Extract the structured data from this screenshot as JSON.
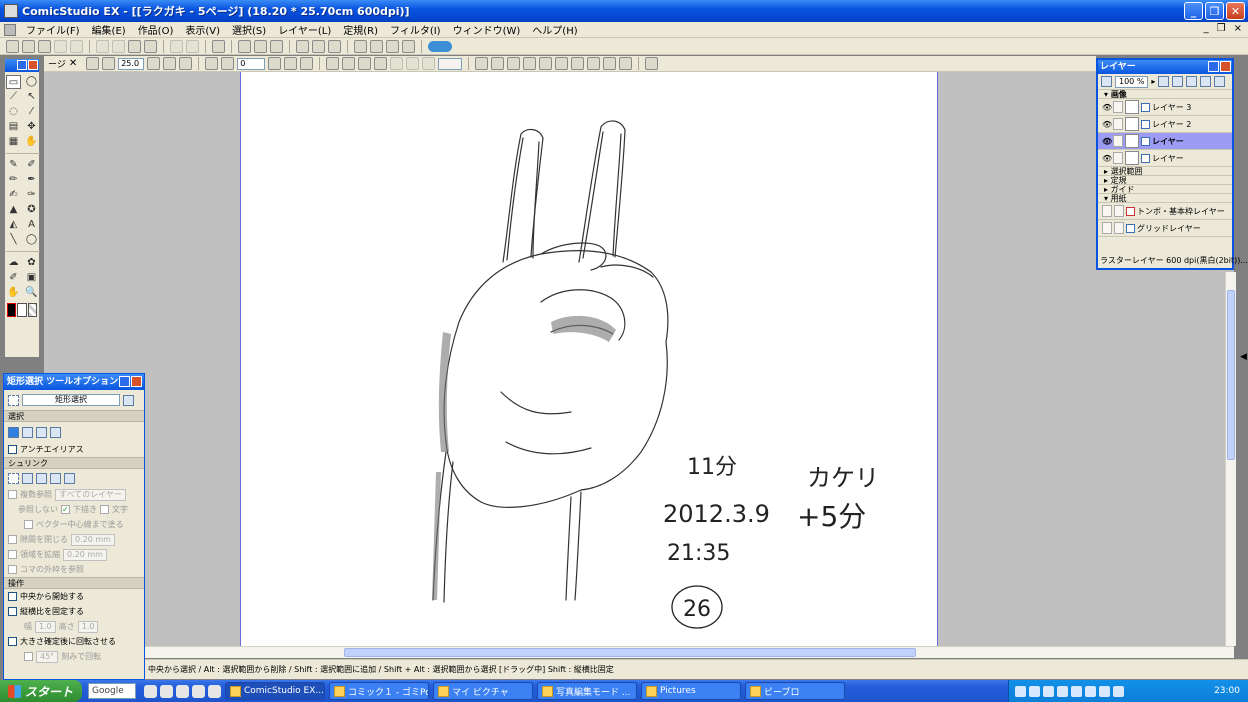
{
  "window": {
    "title": "ComicStudio EX - [[ラクガキ - 5ページ] (18.20 * 25.70cm 600dpi)]",
    "min_label": "_",
    "max_label": "❐",
    "close_label": "✕"
  },
  "menu": {
    "items": [
      "ファイル(F)",
      "編集(E)",
      "作品(O)",
      "表示(V)",
      "選択(S)",
      "レイヤー(L)",
      "定規(R)",
      "フィルタ(I)",
      "ウィンドウ(W)",
      "ヘルプ(H)"
    ],
    "mdi_min": "_",
    "mdi_restore": "❐",
    "mdi_close": "×"
  },
  "toolbar2": {
    "tab_label": "ージ",
    "tab_close": "✕",
    "zoom_value": "25.0",
    "rotate_value": "0"
  },
  "tool_palette": {
    "tools": [
      "▭",
      "◯",
      "⟋",
      "↖",
      "◌",
      "⁄",
      "▤",
      "✥",
      "▦",
      "✋",
      "✎",
      "✐",
      "✏",
      "✒",
      "✍",
      "✑",
      "▲",
      "✪",
      "◭",
      "A",
      "╲",
      "◯",
      "☁",
      "✿",
      "✐",
      "▣",
      "✋",
      "🔍"
    ],
    "colors": {
      "main": "#000000",
      "sub": "#ffffff",
      "transparent": "#d0d0d0"
    }
  },
  "tool_options": {
    "title": "矩形選択 ツールオプション",
    "tool_name": "矩形選択",
    "sections": {
      "selection": "選択",
      "sampling": "シュリンク",
      "operation": "操作"
    },
    "antialias": "アンチエイリアス",
    "multi_ref": "複数参照",
    "multi_ref_value": "すべてのレイヤー",
    "no_ref": "参照しない",
    "lower": "下描き",
    "text": "文字",
    "vector_center": "ベクター中心線まで塗る",
    "close_gap": "隙間を閉じる",
    "close_gap_value": "0.20 mm",
    "expand": "領域を拡縮",
    "expand_value": "0.20 mm",
    "frame_ref": "コマの外枠を参照",
    "start_center": "中央から開始する",
    "fix_ratio": "縦横比を固定する",
    "ratio_w_label": "幅",
    "ratio_w": "1.0",
    "ratio_h_label": "高さ",
    "ratio_h": "1.0",
    "rotate_after": "大きさ確定後に回転させる",
    "rotate_value": "45°",
    "rotate_snap": "刻みで回転"
  },
  "layers": {
    "title": "レイヤー",
    "opacity": "100 %",
    "group_image": "画像",
    "rows": [
      {
        "name": "レイヤー 3",
        "active": false
      },
      {
        "name": "レイヤー 2",
        "active": false
      },
      {
        "name": "レイヤー",
        "active": true
      },
      {
        "name": "レイヤー",
        "active": false
      }
    ],
    "group_selection": "選択範囲",
    "group_ruler": "定規",
    "group_guide": "ガイド",
    "group_paper": "用紙",
    "paper_rows": [
      "トンボ・基本枠レイヤー",
      "グリッドレイヤー"
    ],
    "status": "ラスターレイヤー 600 dpi(黒白(2bit))..."
  },
  "canvas_notes": {
    "minutes": "11分",
    "date": "2012.3.9",
    "time": "21:35",
    "number": "26",
    "extra1": "カケリ",
    "extra2": "+5分"
  },
  "status_bar": {
    "text": "中央から選択 / Alt : 選択範囲から削除 / Shift : 選択範囲に追加 / Shift + Alt : 選択範囲から選択 [ドラッグ中] Shift : 縦横比固定"
  },
  "taskbar": {
    "start": "スタート",
    "search": "Google",
    "tasks": [
      {
        "label": "ComicStudio EX...",
        "active": true
      },
      {
        "label": "コミック１ - ゴミPo!",
        "active": false
      },
      {
        "label": "マイ ピクチャ",
        "active": false
      },
      {
        "label": "写真編集モード ...",
        "active": false
      },
      {
        "label": "Pictures",
        "active": false
      },
      {
        "label": "ビーブロ",
        "active": false
      }
    ],
    "clock": "23:00"
  },
  "colors": {
    "title_blue": "#0a55e0",
    "active_layer": "#9c9cf5",
    "start_green": "#2e8c2e"
  }
}
